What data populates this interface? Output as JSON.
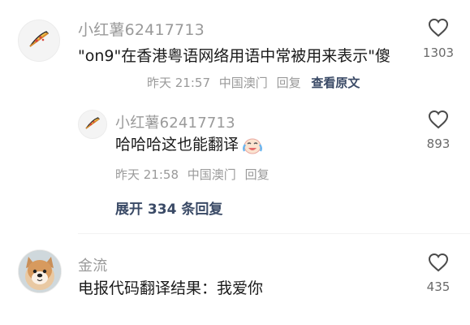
{
  "comments": [
    {
      "username": "小红薯62417713",
      "text": "\"on9\"在香港粤语网络用语中常被用来表示\"傻",
      "time": "昨天 21:57",
      "location": "中国澳门",
      "reply_label": "回复",
      "view_original_label": "查看原文",
      "like_count": "1303",
      "reply": {
        "username": "小红薯62417713",
        "text": "哈哈哈这也能翻译",
        "time": "昨天 21:58",
        "location": "中国澳门",
        "reply_label": "回复",
        "like_count": "893"
      },
      "expand_label": "展开 334 条回复"
    },
    {
      "username": "金流",
      "text": "电报代码翻译结果：我爱你",
      "like_count": "435"
    }
  ]
}
